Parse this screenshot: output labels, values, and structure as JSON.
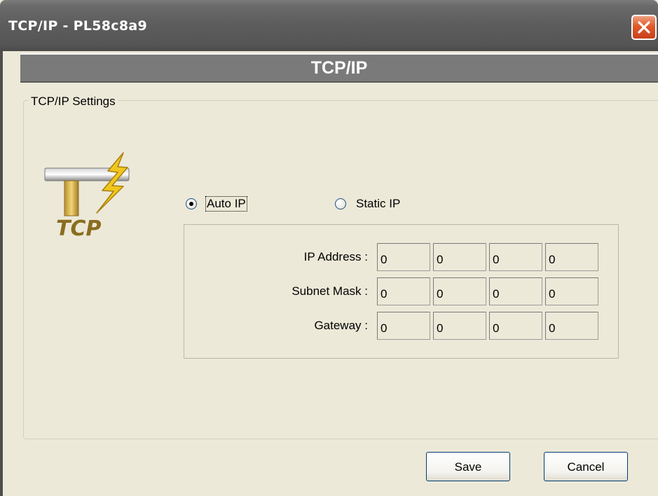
{
  "window": {
    "title": "TCP/IP - PL58c8a9"
  },
  "header": {
    "title": "TCP/IP"
  },
  "group": {
    "legend": "TCP/IP Settings"
  },
  "logo": {
    "text": "TCP"
  },
  "mode": {
    "auto_label": "Auto IP",
    "static_label": "Static IP",
    "selected": "auto"
  },
  "fields": [
    {
      "label": "IP Address :",
      "octets": [
        "0",
        "0",
        "0",
        "0"
      ]
    },
    {
      "label": "Subnet Mask :",
      "octets": [
        "0",
        "0",
        "0",
        "0"
      ]
    },
    {
      "label": "Gateway :",
      "octets": [
        "0",
        "0",
        "0",
        "0"
      ]
    }
  ],
  "buttons": {
    "save": "Save",
    "cancel": "Cancel"
  },
  "colors": {
    "titlebar": "#5c5c5c",
    "header_band": "#7a7a7a",
    "close": "#e05a2a",
    "logo_bar": "#d9b34a",
    "logo_bolt": "#f0c61e",
    "logo_text": "#8a6d1f"
  }
}
